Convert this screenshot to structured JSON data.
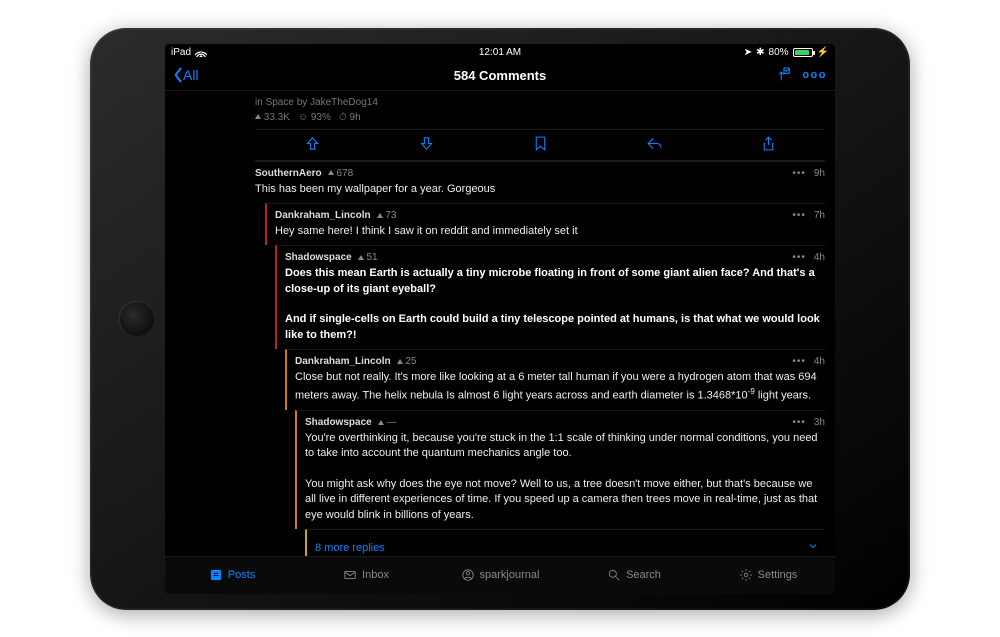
{
  "status": {
    "carrier": "iPad",
    "time": "12:01 AM",
    "battery_pct": "80%"
  },
  "nav": {
    "back_label": "All",
    "title": "584 Comments"
  },
  "post": {
    "in_label": "in",
    "subreddit": "Space",
    "by_label": "by",
    "author": "JakeTheDog14",
    "score": "33.3K",
    "ratio": "93%",
    "age": "9h"
  },
  "comments": [
    {
      "depth": 0,
      "user": "SouthernAero",
      "score": "678",
      "age": "9h",
      "body_html": "This has been my wallpaper for a year. Gorgeous"
    },
    {
      "depth": 1,
      "user": "Dankraham_Lincoln",
      "score": "73",
      "age": "7h",
      "body_html": "Hey same here! I think I saw it on reddit and immediately set it"
    },
    {
      "depth": 2,
      "user": "Shadowspace",
      "score": "51",
      "age": "4h",
      "body_html": "<strong>Does this mean Earth is actually a tiny microbe floating in front of some giant alien face? And that's a close-up of its giant eyeball?</strong><br><br><strong>And if single-cells on Earth could build a tiny telescope pointed at humans, is that what we would look like to them?!</strong>"
    },
    {
      "depth": 3,
      "user": "Dankraham_Lincoln",
      "score": "25",
      "age": "4h",
      "body_html": "Close but not really. It's more like looking at a 6 meter tall human if you were a hydrogen atom that was 694 meters away. The helix nebula Is almost 6 light years across and earth diameter is 1.3468*10<sup>-9</sup> light years."
    },
    {
      "depth": 4,
      "user": "Shadowspace",
      "score": "—",
      "age": "3h",
      "body_html": "You're overthinking it, because you're stuck in the 1:1 scale of thinking under normal conditions, you need to take into account the quantum mechanics angle too.<br><br>You might ask why does the eye not move? Well to us, a tree doesn't move either, but that's because we all live in different experiences of time. If you speed up a camera then trees move in real-time, just as that eye would blink in billions of years."
    }
  ],
  "more_replies": "8 more replies",
  "toolbar": {
    "posts": "Posts",
    "inbox": "Inbox",
    "profile": "sparkjournal",
    "search": "Search",
    "settings": "Settings"
  },
  "icons": {
    "ellipsis": "•••",
    "more_options": "ooo"
  }
}
